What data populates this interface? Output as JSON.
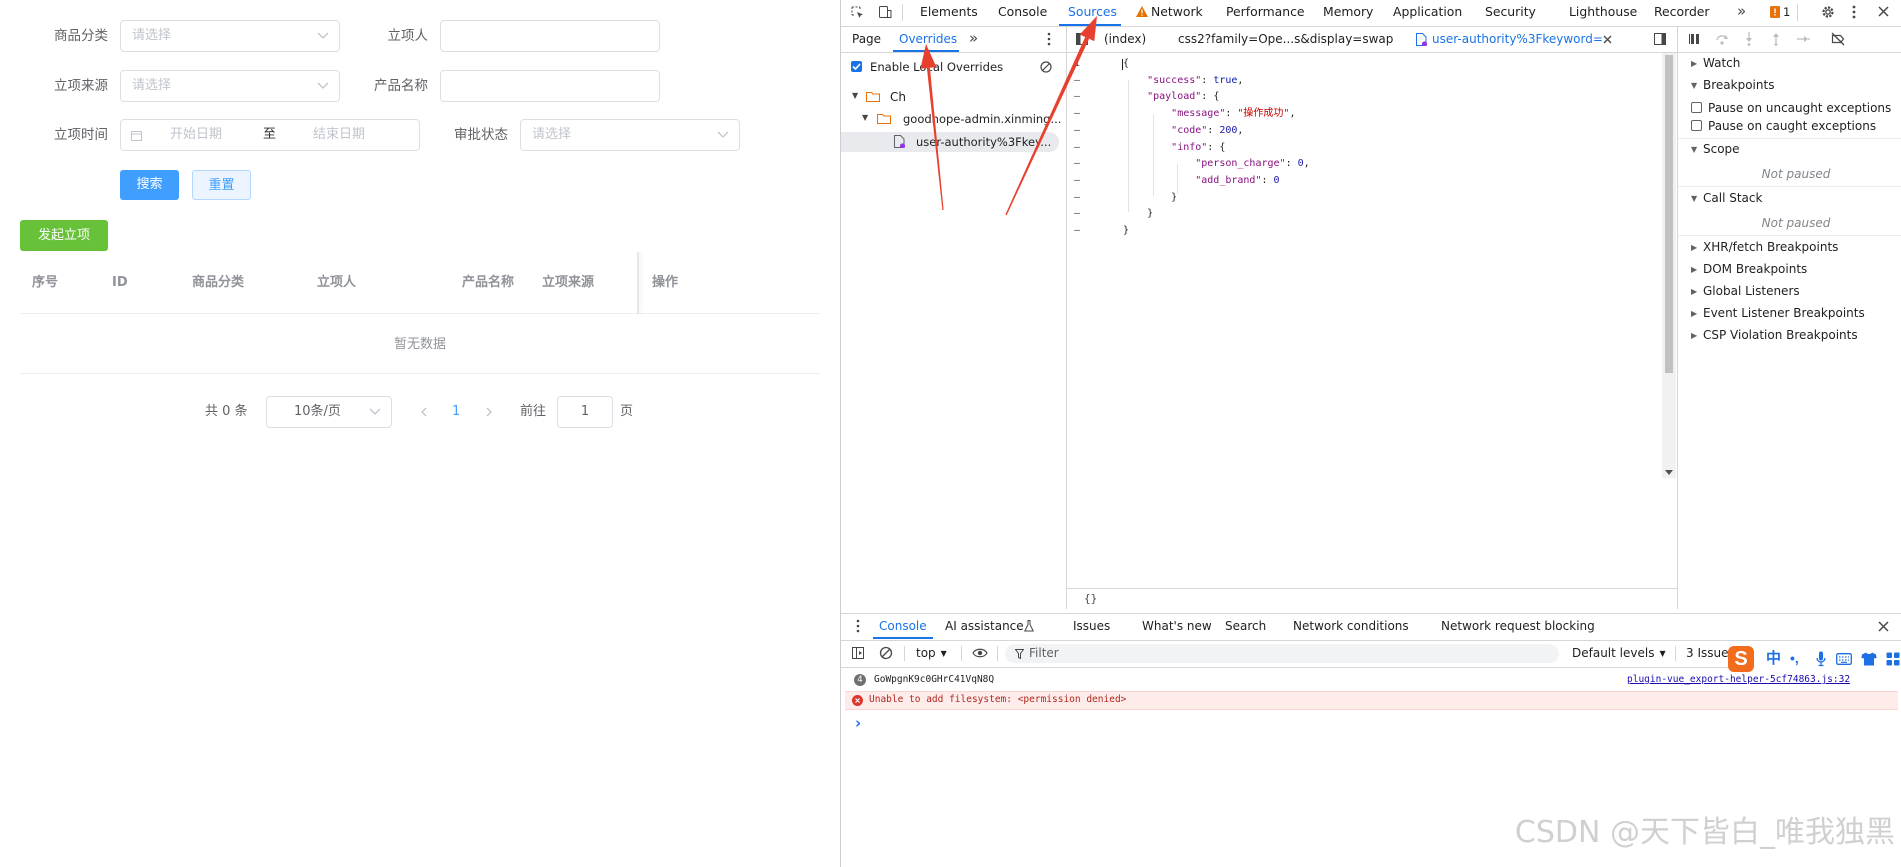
{
  "app": {
    "filters": {
      "category": {
        "label": "商品分类",
        "placeholder": "请选择"
      },
      "initiator": {
        "label": "立项人",
        "value": ""
      },
      "source": {
        "label": "立项来源",
        "placeholder": "请选择"
      },
      "product_name": {
        "label": "产品名称",
        "value": ""
      },
      "time": {
        "label": "立项时间",
        "start_placeholder": "开始日期",
        "separator": "至",
        "end_placeholder": "结束日期"
      },
      "approval": {
        "label": "审批状态",
        "placeholder": "请选择"
      }
    },
    "buttons": {
      "search": "搜索",
      "reset": "重置",
      "create": "发起立项"
    },
    "table": {
      "columns": [
        "序号",
        "ID",
        "商品分类",
        "立项人",
        "产品名称",
        "立项来源",
        "操作"
      ],
      "empty_text": "暂无数据"
    },
    "pagination": {
      "total_text": "共 0 条",
      "page_size": "10条/页",
      "current_page": "1",
      "goto_label": "前往",
      "goto_value": "1",
      "page_suffix": "页"
    }
  },
  "devtools": {
    "main_tabs": [
      "Elements",
      "Console",
      "Sources",
      "Network",
      "Performance",
      "Memory",
      "Application",
      "Security",
      "Lighthouse",
      "Recorder"
    ],
    "active_main_tab": "Sources",
    "more_tabs": "»",
    "issues_badge": "1",
    "sources": {
      "nav_tabs": [
        "Page",
        "Overrides"
      ],
      "active_nav_tab": "Overrides",
      "nav_more": "»",
      "enable_overrides": {
        "label": "Enable Local Overrides",
        "checked": true
      },
      "tree": [
        {
          "name": "Ch",
          "type": "folder",
          "expanded": true
        },
        {
          "name": "goodhope-admin.xinming...",
          "type": "folder",
          "expanded": true
        },
        {
          "name": "user-authority%3Fkey...",
          "type": "file",
          "selected": true
        }
      ],
      "editor_tabs": [
        "(index)",
        "css2?family=Ope...s&display=swap",
        "user-authority%3Fkeyword="
      ],
      "active_editor_tab": "user-authority%3Fkeyword=",
      "pretty_print": "{}"
    },
    "editor": {
      "gutter": [
        "1",
        "–",
        "–",
        "–",
        "–",
        "–",
        "–",
        "–",
        "–",
        "–",
        "–"
      ],
      "lines": [
        [
          {
            "t": "{",
            "c": "p"
          }
        ],
        [
          {
            "t": "    ",
            "c": "p"
          },
          {
            "t": "\"success\"",
            "c": "key"
          },
          {
            "t": ": ",
            "c": "p"
          },
          {
            "t": "true",
            "c": "bool"
          },
          {
            "t": ",",
            "c": "p"
          }
        ],
        [
          {
            "t": "    ",
            "c": "p"
          },
          {
            "t": "\"payload\"",
            "c": "key"
          },
          {
            "t": ": {",
            "c": "p"
          }
        ],
        [
          {
            "t": "        ",
            "c": "p"
          },
          {
            "t": "\"message\"",
            "c": "key"
          },
          {
            "t": ": ",
            "c": "p"
          },
          {
            "t": "\"操作成功\"",
            "c": "string"
          },
          {
            "t": ",",
            "c": "p"
          }
        ],
        [
          {
            "t": "        ",
            "c": "p"
          },
          {
            "t": "\"code\"",
            "c": "key"
          },
          {
            "t": ": ",
            "c": "p"
          },
          {
            "t": "200",
            "c": "number"
          },
          {
            "t": ",",
            "c": "p"
          }
        ],
        [
          {
            "t": "        ",
            "c": "p"
          },
          {
            "t": "\"info\"",
            "c": "key"
          },
          {
            "t": ": {",
            "c": "p"
          }
        ],
        [
          {
            "t": "            ",
            "c": "p"
          },
          {
            "t": "\"person_charge\"",
            "c": "key"
          },
          {
            "t": ": ",
            "c": "p"
          },
          {
            "t": "0",
            "c": "number"
          },
          {
            "t": ",",
            "c": "p"
          }
        ],
        [
          {
            "t": "            ",
            "c": "p"
          },
          {
            "t": "\"add_brand\"",
            "c": "key"
          },
          {
            "t": ": ",
            "c": "p"
          },
          {
            "t": "0",
            "c": "number"
          }
        ],
        [
          {
            "t": "        ",
            "c": "p"
          },
          {
            "t": "}",
            "c": "p"
          }
        ],
        [
          {
            "t": "    ",
            "c": "p"
          },
          {
            "t": "}",
            "c": "p"
          }
        ],
        [
          {
            "t": "}",
            "c": "p"
          }
        ]
      ]
    },
    "debugger": {
      "watch": "Watch",
      "breakpoints": "Breakpoints",
      "pause_uncaught": "Pause on uncaught exceptions",
      "pause_caught": "Pause on caught exceptions",
      "scope": "Scope",
      "scope_status": "Not paused",
      "call_stack": "Call Stack",
      "call_stack_status": "Not paused",
      "xhr": "XHR/fetch Breakpoints",
      "dom": "DOM Breakpoints",
      "global": "Global Listeners",
      "event": "Event Listener Breakpoints",
      "csp": "CSP Violation Breakpoints"
    },
    "drawer": {
      "tabs": [
        "Console",
        "AI assistance",
        "Issues",
        "What's new",
        "Search",
        "Network conditions",
        "Network request blocking"
      ],
      "active_tab": "Console",
      "context": "top",
      "filter_placeholder": "Filter",
      "levels": "Default levels",
      "issues": "3 Issues",
      "messages": [
        {
          "type": "log",
          "count": "4",
          "text": "GoWpgnK9c0GHrC41VqN8Q",
          "source": "plugin-vue_export-helper-5cf74863.js:32"
        },
        {
          "type": "error",
          "text": "Unable to add filesystem: <permission denied>"
        }
      ],
      "prompt": "›"
    }
  },
  "ime": {
    "logo": "S",
    "mode": "中",
    "punct": "•,"
  },
  "watermark": "CSDN @天下皆白_唯我独黑",
  "colors": {
    "primary": "#409eff",
    "success": "#67c23a",
    "devtools_accent": "#1a73e8",
    "error": "#d93025",
    "annotation_arrow": "#e8402f"
  }
}
